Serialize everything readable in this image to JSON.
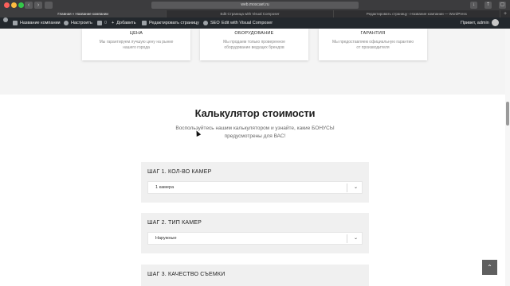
{
  "browser": {
    "url": "web.moscaet.ru",
    "tabs": [
      {
        "label": "Главная « Название компании",
        "active": true
      },
      {
        "label": "Edit Страница with Visual Composer",
        "active": false
      },
      {
        "label": "Редактировать страницу ‹ Название компании — WordPress",
        "active": false
      }
    ],
    "new_tab_label": "+"
  },
  "adminbar": {
    "site_name": "Название компании",
    "customize": "Настроить",
    "comments_count": "0",
    "add_new": "Добавить",
    "edit_page": "Редактировать страницу",
    "seo": "SEO",
    "visual_composer": "Edit with Visual Composer",
    "greeting": "Привет, admin"
  },
  "features": [
    {
      "title": "ЦЕНА",
      "text": "Мы гарантируем лучшую цену на рынке нашего города"
    },
    {
      "title": "ОБОРУДОВАНИЕ",
      "text": "Мы продаем только проверенное оборудование ведущих брендов"
    },
    {
      "title": "ГАРАНТИЯ",
      "text": "Мы предоставляем официальную гарантию от производителя"
    }
  ],
  "calculator": {
    "title": "Калькулятор стоимости",
    "subtitle": "Воспользуйтесь нашим калькулятором и узнайте, какие БОНУСЫ предусмотрены для ВАС!",
    "steps": [
      {
        "label": "ШАГ 1. КОЛ-ВО КАМЕР",
        "value": "1 камера"
      },
      {
        "label": "ШАГ 2. ТИП КАМЕР",
        "value": "Наружные"
      },
      {
        "label": "ШАГ 3. КАЧЕСТВО СЪЕМКИ",
        "value": ""
      }
    ]
  },
  "icons": {
    "back": "chevron-left-icon",
    "forward": "chevron-right-icon",
    "to_top": "arrow-up-icon",
    "dropdown": "chevron-down-icon"
  }
}
